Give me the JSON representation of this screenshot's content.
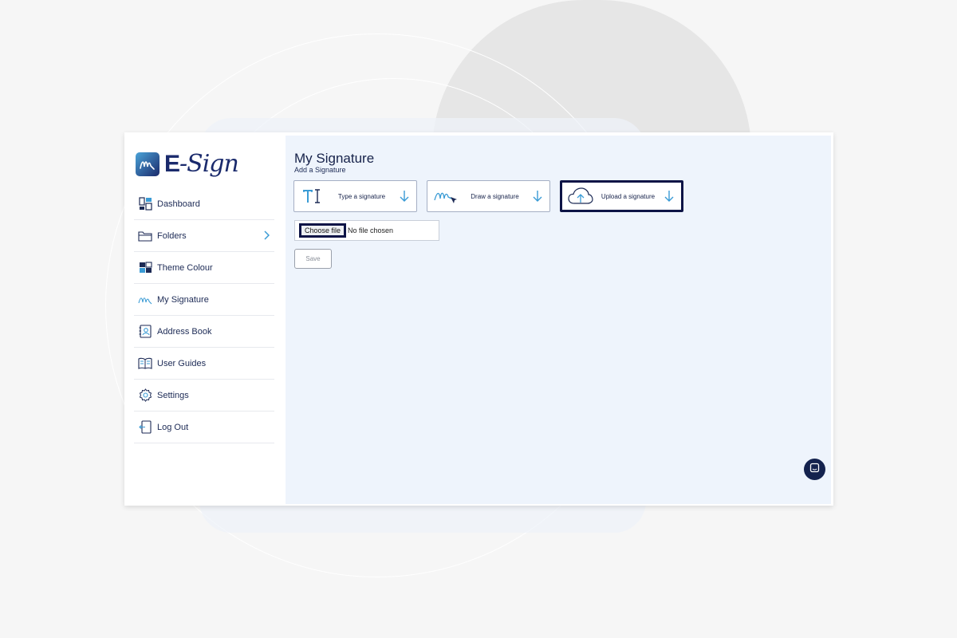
{
  "app": {
    "logo_prefix": "E",
    "logo_suffix": "-Sign"
  },
  "sidebar": {
    "items": [
      {
        "label": "Dashboard",
        "icon": "dashboard-icon"
      },
      {
        "label": "Folders",
        "icon": "folder-icon",
        "has_chevron": true
      },
      {
        "label": "Theme Colour",
        "icon": "theme-colour-icon"
      },
      {
        "label": "My Signature",
        "icon": "signature-icon"
      },
      {
        "label": "Address Book",
        "icon": "address-book-icon"
      },
      {
        "label": "User Guides",
        "icon": "book-icon"
      },
      {
        "label": "Settings",
        "icon": "gear-icon"
      },
      {
        "label": "Log Out",
        "icon": "logout-icon"
      }
    ]
  },
  "main": {
    "title": "My Signature",
    "subtitle": "Add a Signature",
    "options": [
      {
        "label": "Type a signature",
        "icon": "text-icon"
      },
      {
        "label": "Draw a signature",
        "icon": "pen-scribble-icon"
      },
      {
        "label": "Upload a signature",
        "icon": "cloud-upload-icon",
        "selected": true
      }
    ],
    "file_input": {
      "button_label": "Choose file",
      "status": "No file chosen"
    },
    "save_label": "Save"
  },
  "colors": {
    "navy": "#1c2a55",
    "accent": "#3a9bd5",
    "selection_border": "#0d1446",
    "main_bg": "#eef4fc"
  }
}
